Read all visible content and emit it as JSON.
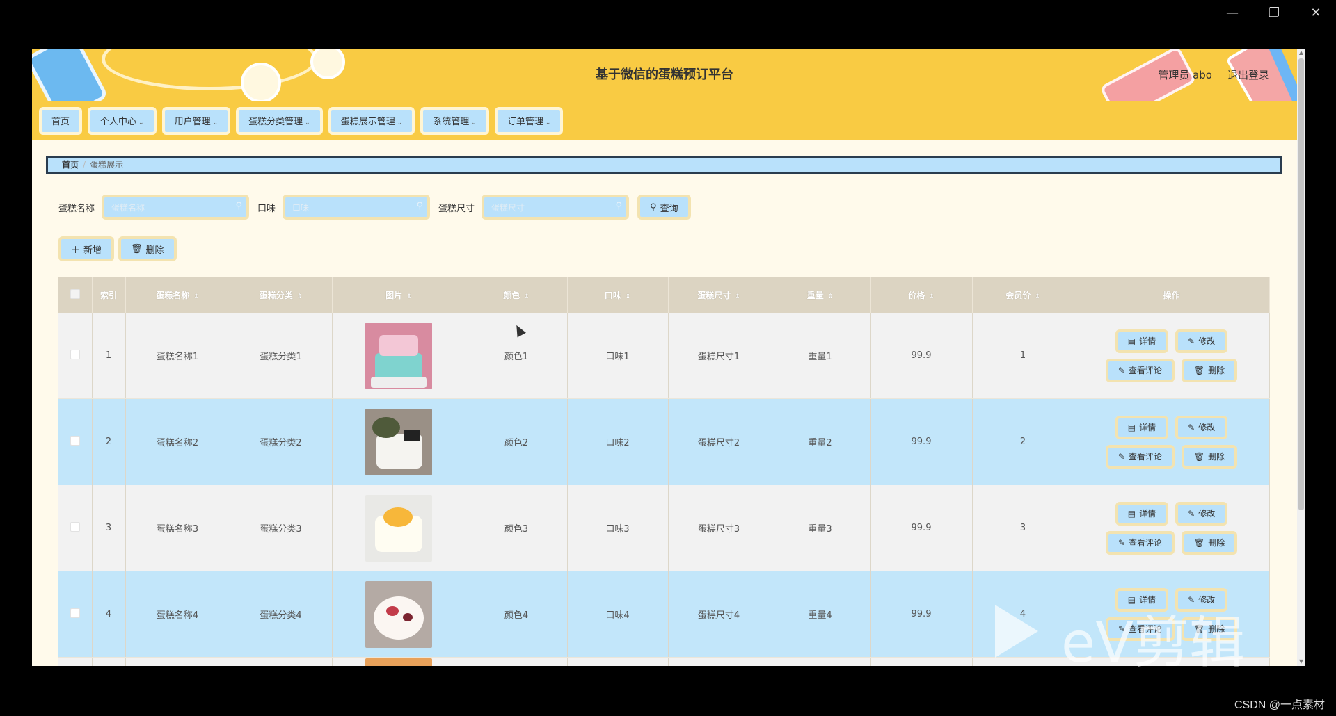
{
  "window_controls": {
    "minimize": "—",
    "restore": "❐",
    "close": "✕"
  },
  "header": {
    "title": "基于微信的蛋糕预订平台",
    "user_label": "管理员 abo",
    "logout_label": "退出登录"
  },
  "nav": [
    {
      "label": "首页",
      "dropdown": false
    },
    {
      "label": "个人中心",
      "dropdown": true
    },
    {
      "label": "用户管理",
      "dropdown": true
    },
    {
      "label": "蛋糕分类管理",
      "dropdown": true
    },
    {
      "label": "蛋糕展示管理",
      "dropdown": true
    },
    {
      "label": "系统管理",
      "dropdown": true
    },
    {
      "label": "订单管理",
      "dropdown": true
    }
  ],
  "breadcrumb": {
    "home": "首页",
    "sep": "/",
    "current": "蛋糕展示"
  },
  "search": {
    "name_label": "蛋糕名称",
    "name_placeholder": "蛋糕名称",
    "flavor_label": "口味",
    "flavor_placeholder": "口味",
    "size_label": "蛋糕尺寸",
    "size_placeholder": "蛋糕尺寸",
    "query_label": "查询"
  },
  "actions": {
    "add_label": "新增",
    "delete_label": "删除"
  },
  "table": {
    "headers": [
      "索引",
      "蛋糕名称",
      "蛋糕分类",
      "图片",
      "颜色",
      "口味",
      "蛋糕尺寸",
      "重量",
      "价格",
      "会员价",
      "操作"
    ],
    "rows": [
      {
        "index": "1",
        "name": "蛋糕名称1",
        "category": "蛋糕分类1",
        "color": "颜色1",
        "flavor": "口味1",
        "size": "蛋糕尺寸1",
        "weight": "重量1",
        "price": "99.9",
        "member_price": "1"
      },
      {
        "index": "2",
        "name": "蛋糕名称2",
        "category": "蛋糕分类2",
        "color": "颜色2",
        "flavor": "口味2",
        "size": "蛋糕尺寸2",
        "weight": "重量2",
        "price": "99.9",
        "member_price": "2"
      },
      {
        "index": "3",
        "name": "蛋糕名称3",
        "category": "蛋糕分类3",
        "color": "颜色3",
        "flavor": "口味3",
        "size": "蛋糕尺寸3",
        "weight": "重量3",
        "price": "99.9",
        "member_price": "3"
      },
      {
        "index": "4",
        "name": "蛋糕名称4",
        "category": "蛋糕分类4",
        "color": "颜色4",
        "flavor": "口味4",
        "size": "蛋糕尺寸4",
        "weight": "重量4",
        "price": "99.9",
        "member_price": "4"
      }
    ],
    "row_actions": {
      "detail": "详情",
      "edit": "修改",
      "comments": "查看评论",
      "delete": "删除"
    }
  },
  "watermark": {
    "text": "eV剪辑"
  },
  "footer_credit": "CSDN @一点素材",
  "colors": {
    "header_bg": "#f9cb43",
    "button_bg": "#b9e1fb",
    "button_border": "#f3e3b0",
    "row_highlight": "#c2e6fa",
    "page_bg": "#fffaeb"
  }
}
